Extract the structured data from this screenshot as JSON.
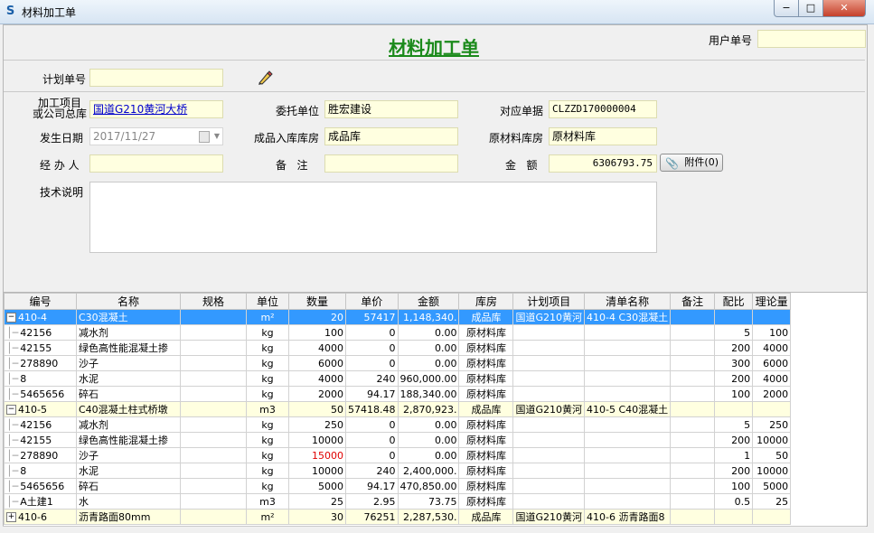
{
  "window": {
    "title": "材料加工单",
    "min": "−",
    "max": "□",
    "close": "✕"
  },
  "header": {
    "doc_title": "材料加工单",
    "user_no_label": "用户单号",
    "user_no_value": "",
    "plan_no_label": "计划单号",
    "plan_no_value": ""
  },
  "fields": {
    "project_label": "加工项目\n或公司总库",
    "project_value": "国道G210黄河大桥",
    "client_label": "委托单位",
    "client_value": "胜宏建设",
    "ref_label": "对应单据",
    "ref_value": "CLZZD170000004",
    "date_label": "发生日期",
    "date_value": "2017/11/27",
    "finished_wh_label": "成品入库库房",
    "finished_wh_value": "成品库",
    "raw_wh_label": "原材料库房",
    "raw_wh_value": "原材料库",
    "handler_label": "经 办 人",
    "handler_value": "",
    "remark_label": "备   注",
    "remark_value": "",
    "amount_label": "金   额",
    "amount_value": "6306793.75",
    "attach_label": "附件(0)",
    "tech_label": "技术说明",
    "tech_value": ""
  },
  "colors": {
    "selected_row": "#3399ff",
    "group_row": "#ffffe0",
    "title_green": "#1b8a1b",
    "alert_red": "#e00000"
  },
  "grid": {
    "columns": [
      "编号",
      "名称",
      "规格",
      "单位",
      "数量",
      "单价",
      "金额",
      "库房",
      "计划项目",
      "清单名称",
      "备注",
      "配比",
      "理论量"
    ],
    "rows": [
      {
        "kind": "sel",
        "toggle": "−",
        "code": "410-4",
        "name": "C30混凝土",
        "spec": "",
        "unit": "m²",
        "qty": "20",
        "price": "57417",
        "amount": "1,148,340.",
        "wh": "成品库",
        "plan": "国道G210黄河",
        "list": "410-4 C30混凝土",
        "note": "",
        "ratio": "",
        "theory": ""
      },
      {
        "kind": "child",
        "code": "42156",
        "name": "减水剂",
        "spec": "",
        "unit": "kg",
        "qty": "100",
        "price": "0",
        "amount": "0.00",
        "wh": "原材料库",
        "plan": "",
        "list": "",
        "note": "",
        "ratio": "5",
        "theory": "100"
      },
      {
        "kind": "child",
        "code": "42155",
        "name": "绿色高性能混凝土掺",
        "spec": "",
        "unit": "kg",
        "qty": "4000",
        "price": "0",
        "amount": "0.00",
        "wh": "原材料库",
        "plan": "",
        "list": "",
        "note": "",
        "ratio": "200",
        "theory": "4000"
      },
      {
        "kind": "child",
        "code": "278890",
        "name": "沙子",
        "spec": "",
        "unit": "kg",
        "qty": "6000",
        "price": "0",
        "amount": "0.00",
        "wh": "原材料库",
        "plan": "",
        "list": "",
        "note": "",
        "ratio": "300",
        "theory": "6000"
      },
      {
        "kind": "child",
        "code": "8",
        "name": "水泥",
        "spec": "",
        "unit": "kg",
        "qty": "4000",
        "price": "240",
        "amount": "960,000.00",
        "wh": "原材料库",
        "plan": "",
        "list": "",
        "note": "",
        "ratio": "200",
        "theory": "4000"
      },
      {
        "kind": "child",
        "code": "5465656",
        "name": "碎石",
        "spec": "",
        "unit": "kg",
        "qty": "2000",
        "price": "94.17",
        "amount": "188,340.00",
        "wh": "原材料库",
        "plan": "",
        "list": "",
        "note": "",
        "ratio": "100",
        "theory": "2000"
      },
      {
        "kind": "grp",
        "toggle": "−",
        "code": "410-5",
        "name": "C40混凝土柱式桥墩",
        "spec": "",
        "unit": "m3",
        "qty": "50",
        "price": "57418.48",
        "amount": "2,870,923.",
        "wh": "成品库",
        "plan": "国道G210黄河",
        "list": "410-5 C40混凝土",
        "note": "",
        "ratio": "",
        "theory": ""
      },
      {
        "kind": "child",
        "code": "42156",
        "name": "减水剂",
        "spec": "",
        "unit": "kg",
        "qty": "250",
        "price": "0",
        "amount": "0.00",
        "wh": "原材料库",
        "plan": "",
        "list": "",
        "note": "",
        "ratio": "5",
        "theory": "250"
      },
      {
        "kind": "child",
        "code": "42155",
        "name": "绿色高性能混凝土掺",
        "spec": "",
        "unit": "kg",
        "qty": "10000",
        "price": "0",
        "amount": "0.00",
        "wh": "原材料库",
        "plan": "",
        "list": "",
        "note": "",
        "ratio": "200",
        "theory": "10000"
      },
      {
        "kind": "child",
        "code": "278890",
        "name": "沙子",
        "spec": "",
        "unit": "kg",
        "qty": "15000",
        "qty_red": true,
        "price": "0",
        "amount": "0.00",
        "wh": "原材料库",
        "plan": "",
        "list": "",
        "note": "",
        "ratio": "1",
        "theory": "50"
      },
      {
        "kind": "child",
        "code": "8",
        "name": "水泥",
        "spec": "",
        "unit": "kg",
        "qty": "10000",
        "price": "240",
        "amount": "2,400,000.",
        "wh": "原材料库",
        "plan": "",
        "list": "",
        "note": "",
        "ratio": "200",
        "theory": "10000"
      },
      {
        "kind": "child",
        "code": "5465656",
        "name": "碎石",
        "spec": "",
        "unit": "kg",
        "qty": "5000",
        "price": "94.17",
        "amount": "470,850.00",
        "wh": "原材料库",
        "plan": "",
        "list": "",
        "note": "",
        "ratio": "100",
        "theory": "5000"
      },
      {
        "kind": "child",
        "code": "A土建1",
        "name": "水",
        "spec": "",
        "unit": "m3",
        "qty": "25",
        "price": "2.95",
        "amount": "73.75",
        "wh": "原材料库",
        "plan": "",
        "list": "",
        "note": "",
        "ratio": "0.5",
        "theory": "25"
      },
      {
        "kind": "grp",
        "toggle": "+",
        "code": "410-6",
        "name": "沥青路面80mm",
        "spec": "",
        "unit": "m²",
        "qty": "30",
        "price": "76251",
        "amount": "2,287,530.",
        "wh": "成品库",
        "plan": "国道G210黄河",
        "list": "410-6 沥青路面8",
        "note": "",
        "ratio": "",
        "theory": ""
      }
    ]
  }
}
